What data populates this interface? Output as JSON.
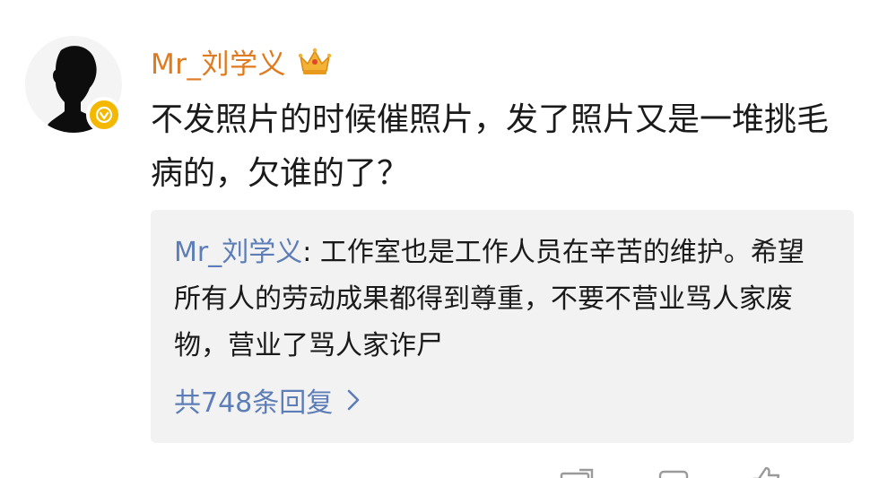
{
  "post": {
    "username": "Mr_刘学义",
    "crown_icon": "crown-icon",
    "verified_badge_icon": "verified-badge-icon",
    "verified_badge_color": "#f5b800",
    "username_color": "#e07a1f",
    "text": "不发照片的时候催照片，发了照片又是一堆挑毛病的，欠谁的了？"
  },
  "reply": {
    "author": "Mr_刘学义",
    "separator": ": ",
    "text": "工作室也是工作人员在辛苦的维护。希望所有人的劳动成果都得到尊重，不要不营业骂人家废物，营业了骂人家诈尸",
    "count_label": "共748条回复",
    "link_color": "#5c7db8"
  },
  "footer": {
    "share_icon": "share-icon",
    "comment_icon": "comment-icon",
    "like_icon": "like-icon"
  }
}
